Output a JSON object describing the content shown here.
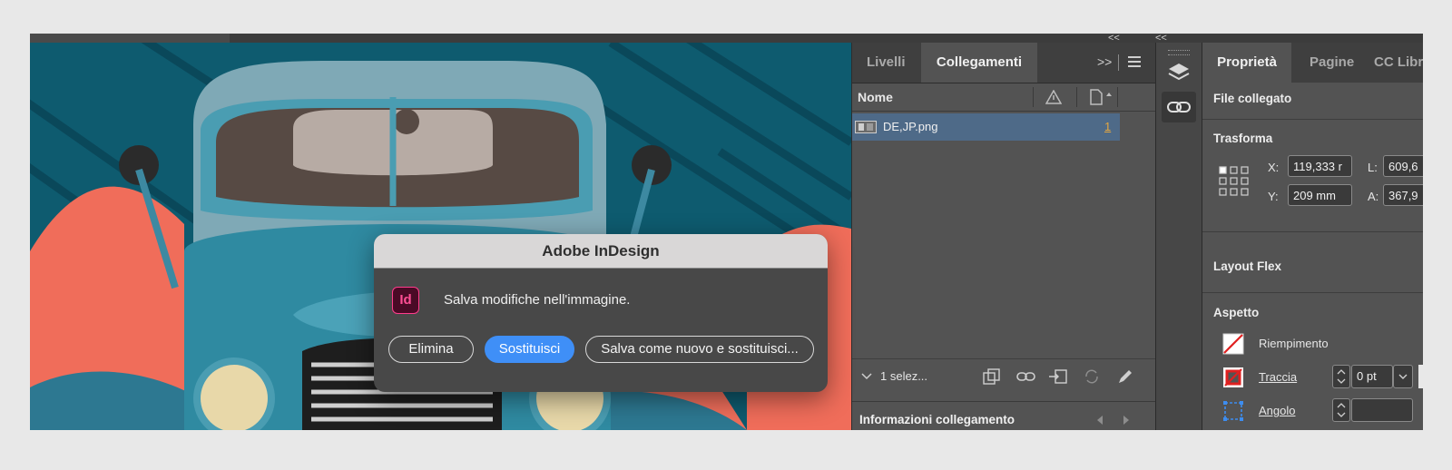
{
  "window": {
    "collapse_glyph": "<<"
  },
  "links_panel": {
    "tabs": [
      "Livelli",
      "Collegamenti"
    ],
    "active_tab": "Collegamenti",
    "more_glyph": ">>",
    "column_name": "Nome",
    "rows": [
      {
        "name": "DE,JP.png",
        "page": "1"
      }
    ],
    "footer_selection": "1 selez...",
    "info_title": "Informazioni collegamento"
  },
  "properties_panel": {
    "tabs": [
      "Proprietà",
      "Pagine",
      "CC Libr"
    ],
    "active_tab": "Proprietà",
    "sections": {
      "linked_file": "File collegato",
      "transform": "Trasforma",
      "layout_flex": "Layout Flex",
      "appearance": "Aspetto"
    },
    "transform": {
      "x_label": "X:",
      "x_value": "119,333 r",
      "y_label": "Y:",
      "y_value": "209 mm",
      "w_label": "L:",
      "w_value": "609,6",
      "h_label": "A:",
      "h_value": "367,9"
    },
    "appearance": {
      "fill_label": "Riempimento",
      "stroke_label": "Traccia",
      "stroke_value": "0 pt",
      "corner_label": "Angolo"
    }
  },
  "dialog": {
    "title": "Adobe InDesign",
    "logo_text": "Id",
    "message": "Salva modifiche nell'immagine.",
    "buttons": {
      "delete": "Elimina",
      "replace": "Sostituisci",
      "save_new_replace": "Salva come nuovo e sostituisci..."
    }
  },
  "colors": {
    "accent": "#3f8ff7",
    "indesign_pink": "#ff3c8c",
    "selected_row": "#4e6a88",
    "page_link": "#e3a640"
  }
}
